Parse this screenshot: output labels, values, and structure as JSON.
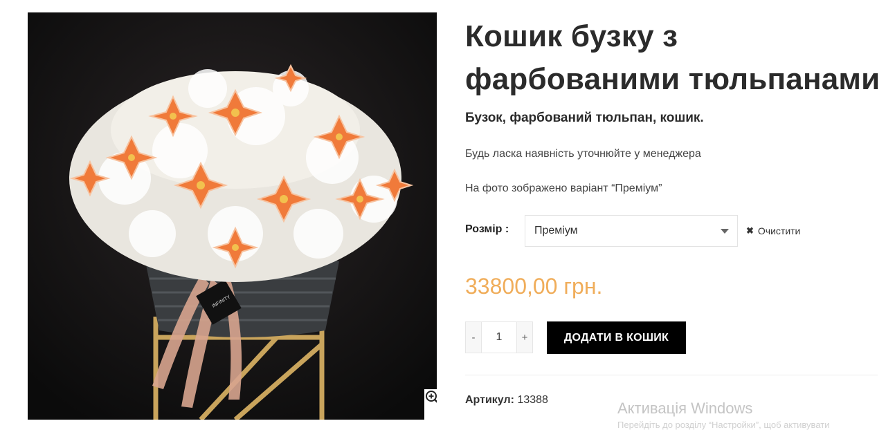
{
  "product": {
    "title": "Кошик бузку з фарбованими тюльпанами",
    "subtitle": "Бузок, фарбований тюльпан, кошик.",
    "note_availability": "Будь ласка наявність уточнюйте у менеджера",
    "note_photo": "На фото зображено варіант “Преміум”",
    "size_label": "Розмір",
    "size_value": "Преміум",
    "clear_label": "Очистити",
    "price": "33800,00 грн.",
    "qty_minus": "-",
    "qty_value": "1",
    "qty_plus": "+",
    "add_to_cart": "ДОДАТИ В КОШИК",
    "sku_label": "Артикул:",
    "sku_value": "13388"
  },
  "image": {
    "zoom_icon": "zoom-in-icon",
    "card_text": "INFINITY"
  },
  "windows_overlay": {
    "title": "Активація Windows",
    "subtitle": "Перейдіть до розділу “Настройки”, щоб активувати"
  },
  "colors": {
    "price": "#f0ad5a",
    "button_bg": "#000000",
    "photo_bg": "#0f0f0f"
  }
}
